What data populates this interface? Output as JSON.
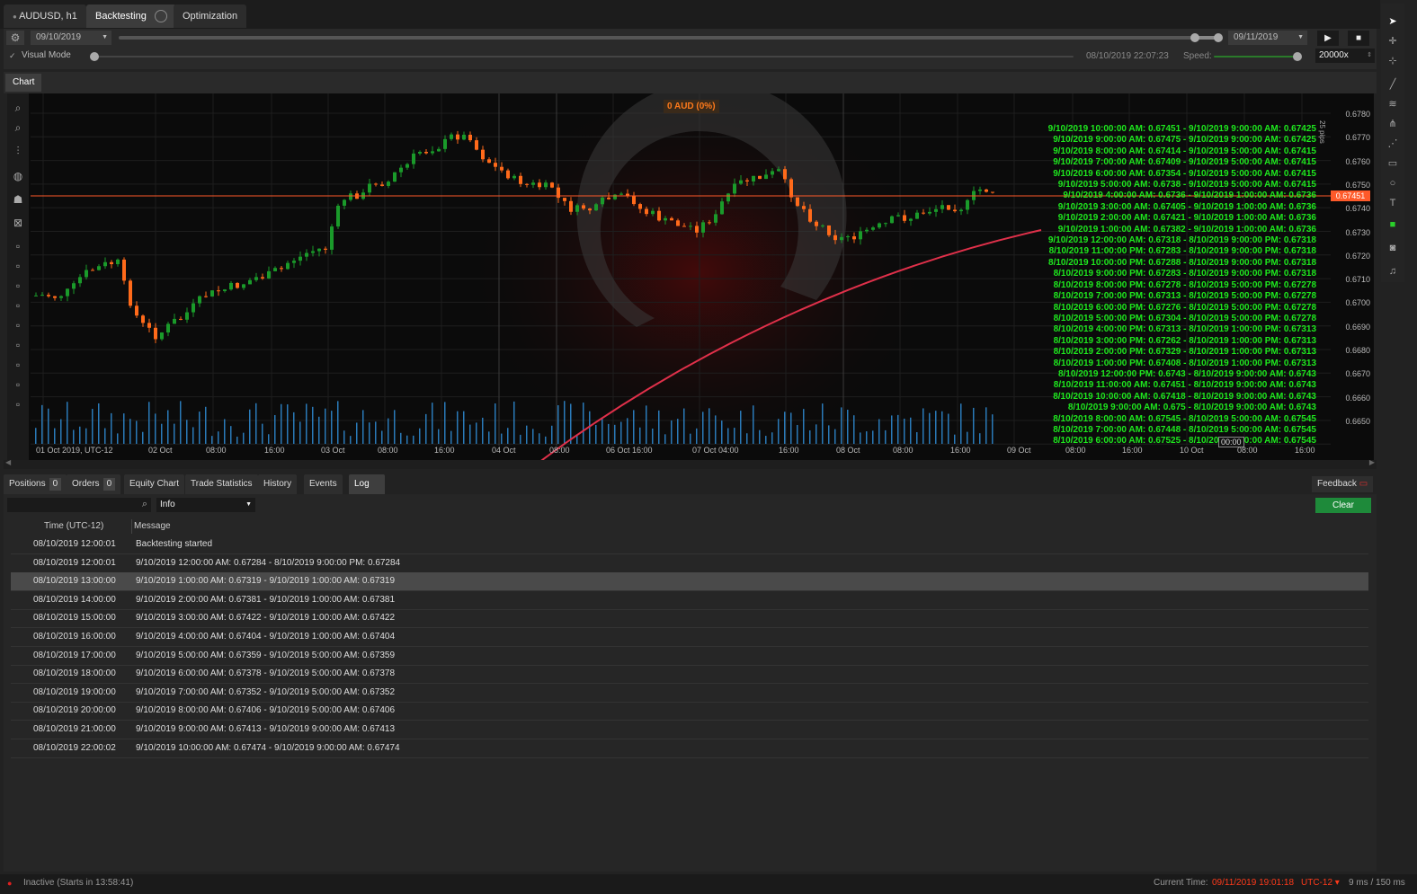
{
  "tabs": [
    {
      "label": "AUDUSD, h1"
    },
    {
      "label": "Backtesting"
    },
    {
      "label": "Optimization"
    }
  ],
  "toolbar": {
    "start_date": "09/10/2019",
    "end_date": "09/11/2019",
    "visual_mode_label": "Visual Mode",
    "current_bar_time": "08/10/2019 22:07:23",
    "speed_label": "Speed:",
    "speed_value": "20000x",
    "play_icon": "▶",
    "stop_icon": "■"
  },
  "chart_tab": "Chart",
  "chart": {
    "pnl_badge": "0 AUD (0%)",
    "pips_label": "25 pips",
    "current_price": "0.67451",
    "price_labels": [
      "0.6780",
      "0.6770",
      "0.6760",
      "0.6750",
      "0.6740",
      "0.6730",
      "0.6720",
      "0.6710",
      "0.6700",
      "0.6690",
      "0.6680",
      "0.6670",
      "0.6660",
      "0.6650"
    ],
    "time_labels": [
      "01 Oct 2019, UTC-12",
      "02 Oct",
      "08:00",
      "16:00",
      "03 Oct",
      "08:00",
      "16:00",
      "04 Oct",
      "08:00",
      "06 Oct 16:00",
      "07 Oct 04:00",
      "16:00",
      "08 Oct",
      "08:00",
      "16:00",
      "09 Oct",
      "08:00",
      "16:00",
      "10 Oct",
      "08:00",
      "16:00"
    ],
    "cursor_time": "00:00",
    "green_lines": [
      "9/10/2019 10:00:00 AM: 0.67451 - 9/10/2019 9:00:00 AM: 0.67425",
      "9/10/2019 9:00:00 AM: 0.67475 - 9/10/2019 9:00:00 AM: 0.67425",
      "9/10/2019 8:00:00 AM: 0.67414 - 9/10/2019 5:00:00 AM: 0.67415",
      "9/10/2019 7:00:00 AM: 0.67409 - 9/10/2019 5:00:00 AM: 0.67415",
      "9/10/2019 6:00:00 AM: 0.67354 - 9/10/2019 5:00:00 AM: 0.67415",
      "9/10/2019 5:00:00 AM: 0.6738 - 9/10/2019 5:00:00 AM: 0.67415",
      "9/10/2019 4:00:00 AM: 0.6736 - 9/10/2019 1:00:00 AM: 0.6736",
      "9/10/2019 3:00:00 AM: 0.67405 - 9/10/2019 1:00:00 AM: 0.6736",
      "9/10/2019 2:00:00 AM: 0.67421 - 9/10/2019 1:00:00 AM: 0.6736",
      "9/10/2019 1:00:00 AM: 0.67382 - 9/10/2019 1:00:00 AM: 0.6736",
      "9/10/2019 12:00:00 AM: 0.67318 - 8/10/2019 9:00:00 PM: 0.67318",
      "8/10/2019 11:00:00 PM: 0.67283 - 8/10/2019 9:00:00 PM: 0.67318",
      "8/10/2019 10:00:00 PM: 0.67288 - 8/10/2019 9:00:00 PM: 0.67318",
      "8/10/2019 9:00:00 PM: 0.67283 - 8/10/2019 9:00:00 PM: 0.67318",
      "8/10/2019 8:00:00 PM: 0.67278 - 8/10/2019 5:00:00 PM: 0.67278",
      "8/10/2019 7:00:00 PM: 0.67313 - 8/10/2019 5:00:00 PM: 0.67278",
      "8/10/2019 6:00:00 PM: 0.67276 - 8/10/2019 5:00:00 PM: 0.67278",
      "8/10/2019 5:00:00 PM: 0.67304 - 8/10/2019 5:00:00 PM: 0.67278",
      "8/10/2019 4:00:00 PM: 0.67313 - 8/10/2019 1:00:00 PM: 0.67313",
      "8/10/2019 3:00:00 PM: 0.67262 - 8/10/2019 1:00:00 PM: 0.67313",
      "8/10/2019 2:00:00 PM: 0.67329 - 8/10/2019 1:00:00 PM: 0.67313",
      "8/10/2019 1:00:00 PM: 0.67408 - 8/10/2019 1:00:00 PM: 0.67313",
      "8/10/2019 12:00:00 PM: 0.6743 - 8/10/2019 9:00:00 AM: 0.6743",
      "8/10/2019 11:00:00 AM: 0.67451 - 8/10/2019 9:00:00 AM: 0.6743",
      "8/10/2019 10:00:00 AM: 0.67418 - 8/10/2019 9:00:00 AM: 0.6743",
      "8/10/2019 9:00:00 AM: 0.675 - 8/10/2019 9:00:00 AM: 0.6743",
      "8/10/2019 8:00:00 AM: 0.67545 - 8/10/2019 5:00:00 AM: 0.67545",
      "8/10/2019 7:00:00 AM: 0.67448 - 8/10/2019 5:00:00 AM: 0.67545",
      "8/10/2019 6:00:00 AM: 0.67525 - 8/10/2019 5:00:00 AM: 0.67545"
    ],
    "colors": {
      "bull": "#1a9a2a",
      "bear": "#ff6a1a",
      "volume": "#2a7ab8",
      "price_line": "#ff5a2a",
      "text_green": "#1ee81e"
    }
  },
  "bottom_tabs": [
    {
      "label": "Positions",
      "count": "0"
    },
    {
      "label": "Orders",
      "count": "0"
    },
    {
      "label": "Equity Chart"
    },
    {
      "label": "Trade Statistics"
    },
    {
      "label": "History"
    },
    {
      "label": "Events"
    },
    {
      "label": "Log"
    }
  ],
  "feedback_label": "Feedback",
  "log": {
    "search_placeholder": "",
    "level_value": "Info",
    "clear_label": "Clear",
    "col_time": "Time (UTC-12)",
    "col_message": "Message",
    "rows": [
      {
        "time": "08/10/2019 12:00:01",
        "msg": "Backtesting started"
      },
      {
        "time": "08/10/2019 12:00:01",
        "msg": "9/10/2019 12:00:00 AM: 0.67284 - 8/10/2019 9:00:00 PM: 0.67284"
      },
      {
        "time": "08/10/2019 13:00:00",
        "msg": "9/10/2019 1:00:00 AM: 0.67319 - 9/10/2019 1:00:00 AM: 0.67319"
      },
      {
        "time": "08/10/2019 14:00:00",
        "msg": "9/10/2019 2:00:00 AM: 0.67381 - 9/10/2019 1:00:00 AM: 0.67381"
      },
      {
        "time": "08/10/2019 15:00:00",
        "msg": "9/10/2019 3:00:00 AM: 0.67422 - 9/10/2019 1:00:00 AM: 0.67422"
      },
      {
        "time": "08/10/2019 16:00:00",
        "msg": "9/10/2019 4:00:00 AM: 0.67404 - 9/10/2019 1:00:00 AM: 0.67404"
      },
      {
        "time": "08/10/2019 17:00:00",
        "msg": "9/10/2019 5:00:00 AM: 0.67359 - 9/10/2019 5:00:00 AM: 0.67359"
      },
      {
        "time": "08/10/2019 18:00:00",
        "msg": "9/10/2019 6:00:00 AM: 0.67378 - 9/10/2019 5:00:00 AM: 0.67378"
      },
      {
        "time": "08/10/2019 19:00:00",
        "msg": "9/10/2019 7:00:00 AM: 0.67352 - 9/10/2019 5:00:00 AM: 0.67352"
      },
      {
        "time": "08/10/2019 20:00:00",
        "msg": "9/10/2019 8:00:00 AM: 0.67406 - 9/10/2019 5:00:00 AM: 0.67406"
      },
      {
        "time": "08/10/2019 21:00:00",
        "msg": "9/10/2019 9:00:00 AM: 0.67413 - 9/10/2019 9:00:00 AM: 0.67413"
      },
      {
        "time": "08/10/2019 22:00:02",
        "msg": "9/10/2019 10:00:00 AM: 0.67474 - 9/10/2019 9:00:00 AM: 0.67474"
      }
    ]
  },
  "status": {
    "inactive": "Inactive (Starts in 13:58:41)",
    "current_time_label": "Current Time:",
    "current_time": "09/11/2019 19:01:18",
    "tz": "UTC-12",
    "latency": "9 ms / 150 ms"
  }
}
